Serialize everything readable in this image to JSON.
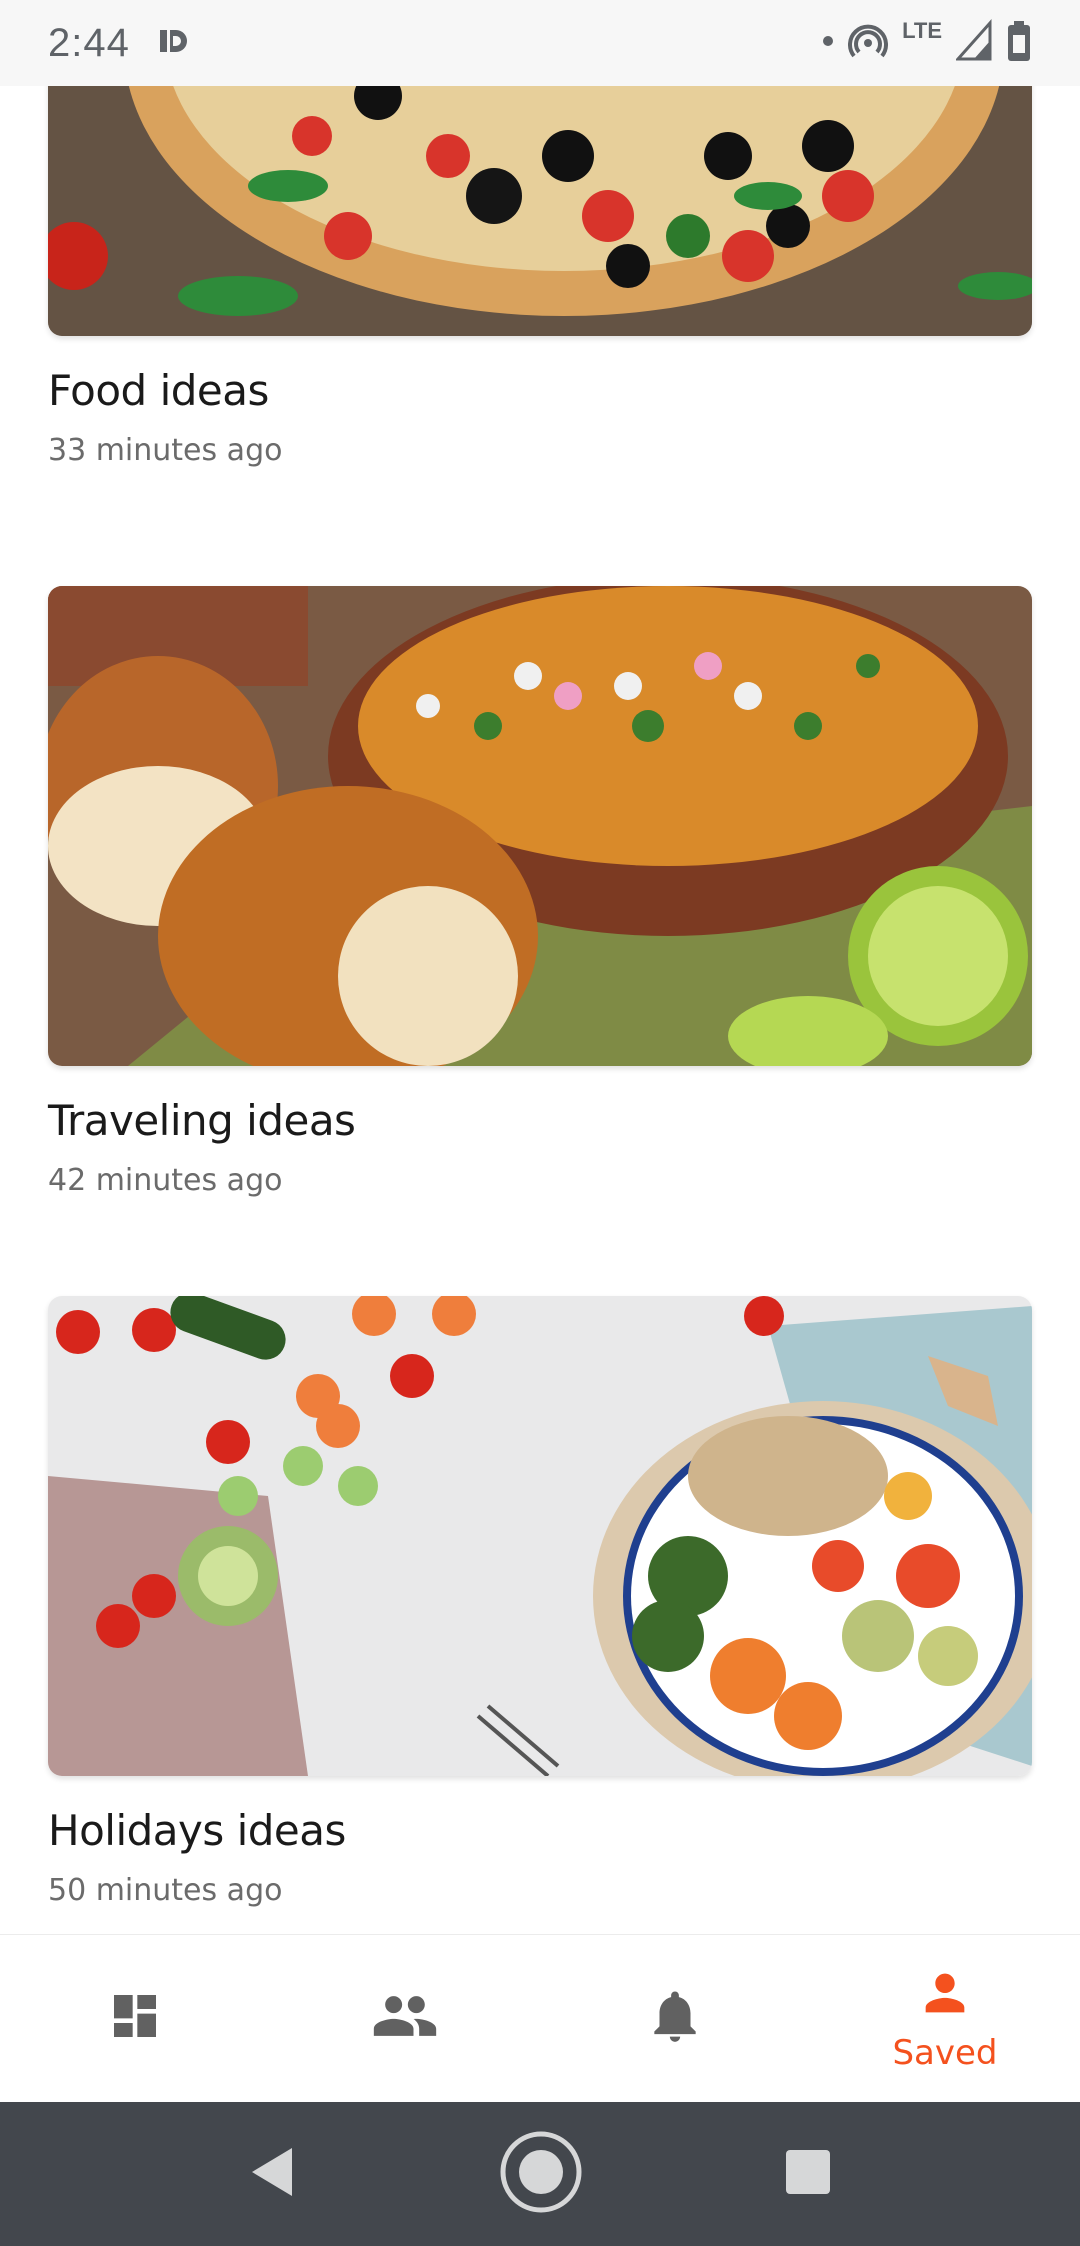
{
  "status_bar": {
    "time": "2:44",
    "network": "LTE"
  },
  "feed": {
    "cards": [
      {
        "title": "Food ideas",
        "time": "33 minutes ago",
        "image": "pizza-photo"
      },
      {
        "title": "Traveling ideas",
        "time": "42 minutes ago",
        "image": "curry-bowl-photo"
      },
      {
        "title": "Holidays ideas",
        "time": "50 minutes ago",
        "image": "vegetable-bowl-photo"
      }
    ]
  },
  "bottom_nav": {
    "items": [
      {
        "icon": "dashboard-icon",
        "label": ""
      },
      {
        "icon": "people-icon",
        "label": ""
      },
      {
        "icon": "bell-icon",
        "label": ""
      },
      {
        "icon": "person-icon",
        "label": "Saved",
        "active": true
      }
    ]
  },
  "colors": {
    "accent": "#f4511e",
    "icon_inactive": "#616161",
    "system_nav": "#43474d"
  }
}
